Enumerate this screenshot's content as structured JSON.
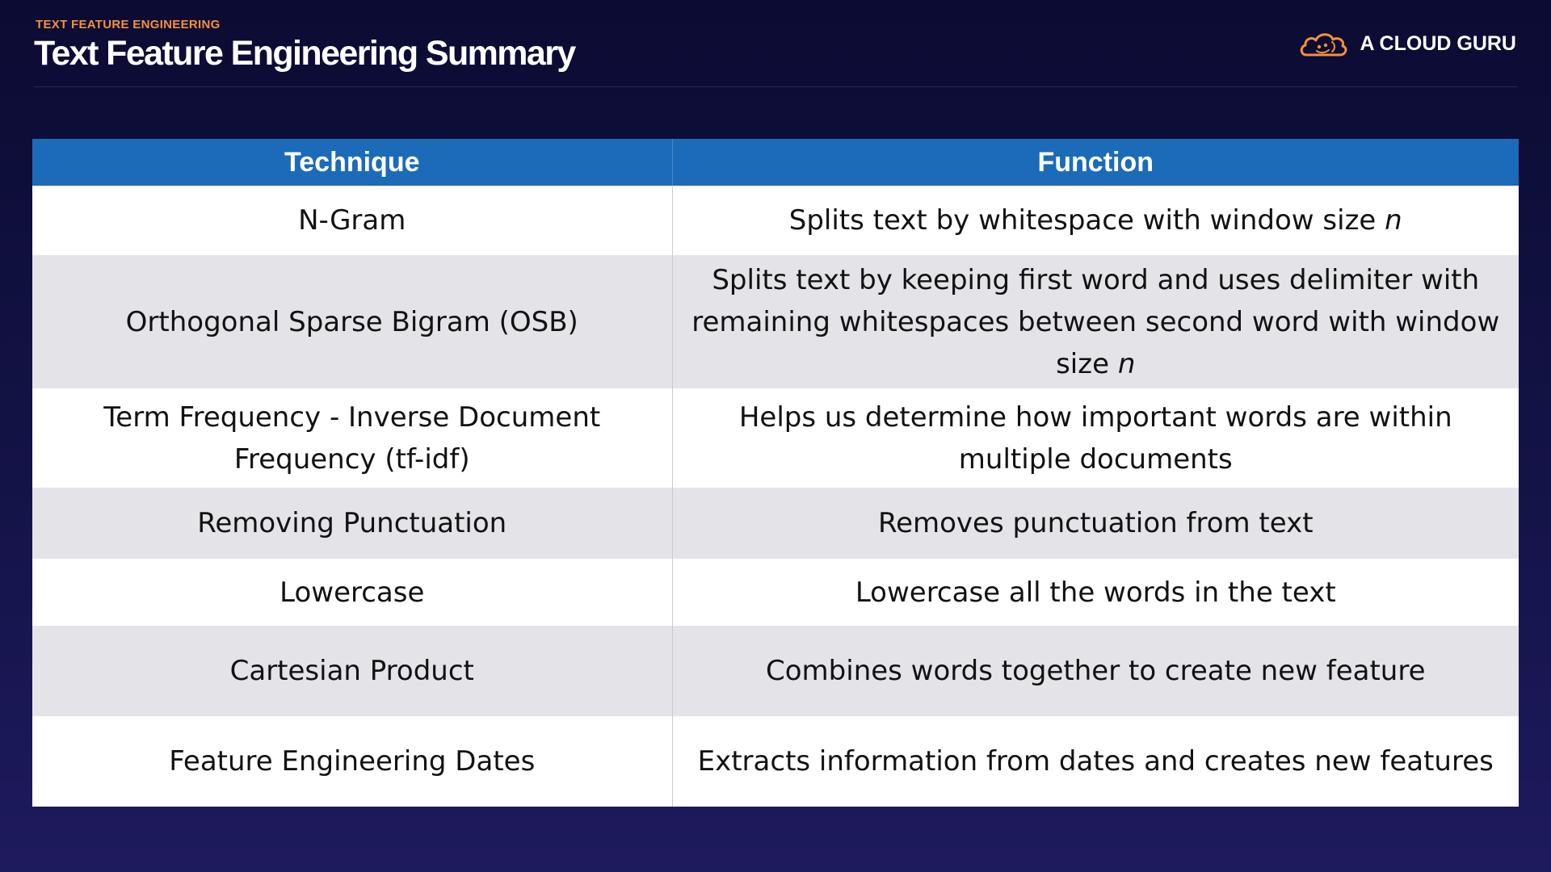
{
  "header": {
    "kicker": "TEXT FEATURE ENGINEERING",
    "title": "Text Feature Engineering Summary",
    "brand_name": "A CLOUD GURU",
    "brand_icon": "cloud-logo-icon",
    "accent_color": "#f5913a"
  },
  "table": {
    "header_color": "#1c6bb9",
    "columns": [
      "Technique",
      "Function"
    ],
    "rows": [
      {
        "technique": "N-Gram",
        "function": "Splits text by whitespace with window size ",
        "function_var": "n"
      },
      {
        "technique": "Orthogonal Sparse Bigram (OSB)",
        "function": "Splits text by keeping first word and uses delimiter with remaining whitespaces between second word with window size ",
        "function_var": "n"
      },
      {
        "technique": "Term Frequency - Inverse Document Frequency (tf-idf)",
        "function": "Helps us determine how important words are within multiple documents"
      },
      {
        "technique": "Removing Punctuation",
        "function": "Removes punctuation from text"
      },
      {
        "technique": "Lowercase",
        "function": "Lowercase all the words in the text"
      },
      {
        "technique": "Cartesian Product",
        "function": "Combines words together to create new feature"
      },
      {
        "technique": "Feature Engineering Dates",
        "function": "Extracts information from dates and creates new features"
      }
    ]
  }
}
